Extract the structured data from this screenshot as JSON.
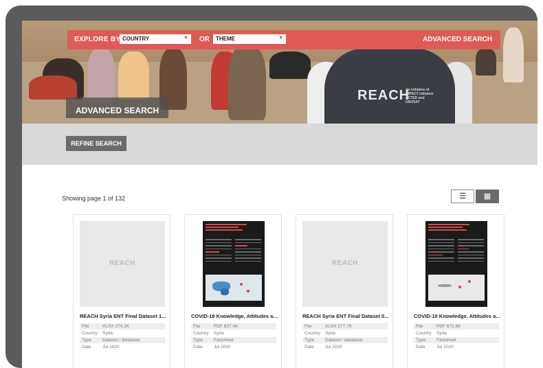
{
  "header": {
    "explore_label": "EXPLORE BY",
    "country_select": "COUNTRY",
    "or_label": "OR",
    "theme_select": "THEME",
    "advanced_link": "ADVANCED SEARCH"
  },
  "hero": {
    "title": "ADVANCED SEARCH",
    "vest_logo": "REACH",
    "vest_tagline": "An initiative of IMPACT initiative ACTED and UNOSAT"
  },
  "refine": {
    "button_label": "REFINE SEARCH"
  },
  "results": {
    "showing": "Showing page 1 of 132",
    "view_list_glyph": "☰",
    "view_grid_glyph": "▦",
    "cards": [
      {
        "title": "REACH Syria ENT Final Dataset 1...",
        "thumb": "placeholder",
        "placeholder_text": "REACH",
        "meta": [
          {
            "k": "File",
            "v": "XLSX 274.2K"
          },
          {
            "k": "Country",
            "v": "Syria"
          },
          {
            "k": "Type",
            "v": "Dataset / database"
          },
          {
            "k": "Date",
            "v": "Jul 2020"
          }
        ]
      },
      {
        "title": "COVID-19 Knowledge, Attitudes a...",
        "thumb": "document",
        "meta": [
          {
            "k": "File",
            "v": "PDF 637.4K"
          },
          {
            "k": "Country",
            "v": "Syria"
          },
          {
            "k": "Type",
            "v": "Factsheet"
          },
          {
            "k": "Date",
            "v": "Jul 2020"
          }
        ]
      },
      {
        "title": "REACH Syria ENT Final Dataset 0...",
        "thumb": "placeholder",
        "placeholder_text": "REACH",
        "meta": [
          {
            "k": "File",
            "v": "XLSX 277.7K"
          },
          {
            "k": "Country",
            "v": "Syria"
          },
          {
            "k": "Type",
            "v": "Dataset / database"
          },
          {
            "k": "Date",
            "v": "Jul 2020"
          }
        ]
      },
      {
        "title": "COVID-19 Knowledge, Attitudes a...",
        "thumb": "document",
        "meta": [
          {
            "k": "File",
            "v": "PDF 672.6K"
          },
          {
            "k": "Country",
            "v": "Syria"
          },
          {
            "k": "Type",
            "v": "Factsheet"
          },
          {
            "k": "Date",
            "v": "Jul 2020"
          }
        ]
      }
    ]
  },
  "colors": {
    "accent": "#e05a55",
    "button_gray": "#6b6b6b",
    "band_gray": "#d9d9d9"
  }
}
